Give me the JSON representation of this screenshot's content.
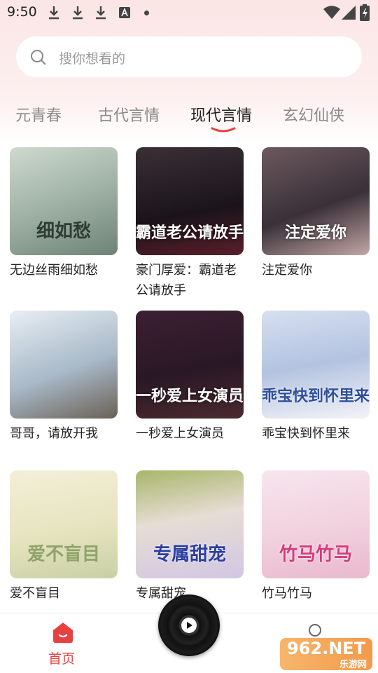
{
  "status_bar": {
    "time": "9:50"
  },
  "search": {
    "placeholder": "搜你想看的"
  },
  "tabs": [
    {
      "label": "元青春"
    },
    {
      "label": "古代言情"
    },
    {
      "label": "现代言情",
      "active": true
    },
    {
      "label": "玄幻仙侠"
    }
  ],
  "books": [
    {
      "title": "无边丝雨细如愁",
      "cover_text": "细如愁"
    },
    {
      "title": "豪门厚爱：霸道老公请放手",
      "cover_text": "霸道老公请放手"
    },
    {
      "title": "注定爱你",
      "cover_text": "注定爱你"
    },
    {
      "title": "哥哥，请放开我",
      "cover_text": ""
    },
    {
      "title": "一秒爱上女演员",
      "cover_text": "一秒爱上女演员"
    },
    {
      "title": "乖宝快到怀里来",
      "cover_text": "乖宝快到怀里来"
    },
    {
      "title": "爱不盲目",
      "cover_text": "爱不盲目"
    },
    {
      "title": "专属甜宠",
      "cover_text": "专属甜宠"
    },
    {
      "title": "竹马竹马",
      "cover_text": "竹马竹马"
    }
  ],
  "bottom_nav": {
    "home_label": "首页"
  },
  "watermark": {
    "text": "962.NET",
    "sub": "乐游网"
  },
  "colors": {
    "accent": "#e84040"
  },
  "icons": [
    "download-icon",
    "a-icon",
    "wifi-icon",
    "signal-icon",
    "battery-icon",
    "search-icon",
    "home-icon",
    "play-icon",
    "profile-icon"
  ]
}
